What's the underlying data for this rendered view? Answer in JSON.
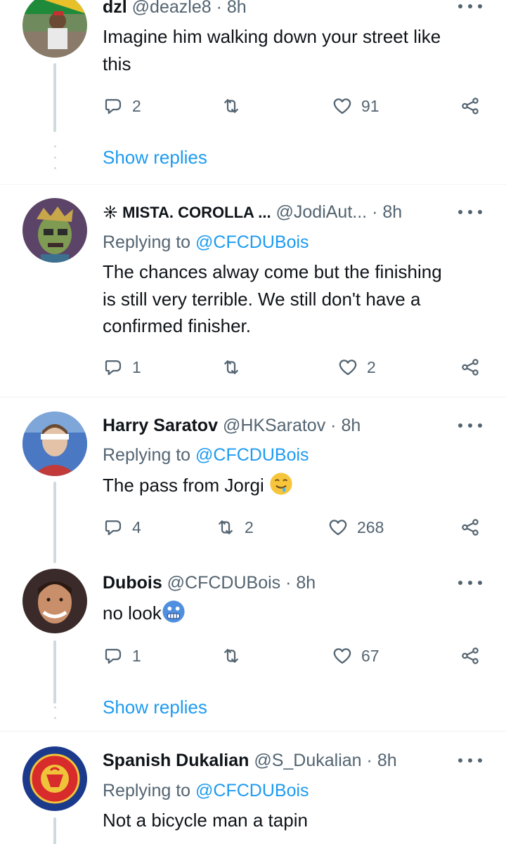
{
  "tweets": [
    {
      "name": "dzl",
      "handle": "@deazle8",
      "time": "8h",
      "text_lines": [
        "Imagine him walking down your street like",
        "this"
      ],
      "replies": "2",
      "retweets": "",
      "likes": "91",
      "show_replies": "Show replies"
    },
    {
      "name": "MISTA. COROLLA ...",
      "handle": "@JodiAut...",
      "time": "8h",
      "replying_prefix": "Replying to",
      "replying_to": "@CFCDUBois",
      "text_lines": [
        "The chances alway come but the finishing",
        "is still very terrible. We still don't have a",
        "confirmed finisher."
      ],
      "replies": "1",
      "retweets": "",
      "likes": "2"
    },
    {
      "name": "Harry Saratov",
      "handle": "@HKSaratov",
      "time": "8h",
      "replying_prefix": "Replying to",
      "replying_to": "@CFCDUBois",
      "text": "The pass from Jorgi",
      "emoji": "drooling-face",
      "replies": "4",
      "retweets": "2",
      "likes": "268"
    },
    {
      "name": "Dubois",
      "handle": "@CFCDUBois",
      "time": "8h",
      "text": "no look",
      "emoji": "cold-face",
      "replies": "1",
      "retweets": "",
      "likes": "67",
      "show_replies": "Show replies"
    },
    {
      "name": "Spanish Dukalian",
      "handle": "@S_Dukalian",
      "time": "8h",
      "replying_prefix": "Replying to",
      "replying_to": "@CFCDUBois",
      "text": "Not a bicycle man a tapin"
    }
  ],
  "separator": "·",
  "colors": {
    "accent": "#1d9bf0",
    "secondary_text": "#536471",
    "thread_line": "#cfd9de"
  },
  "icons": [
    "reply-icon",
    "retweet-icon",
    "like-icon",
    "share-icon",
    "more-icon"
  ]
}
